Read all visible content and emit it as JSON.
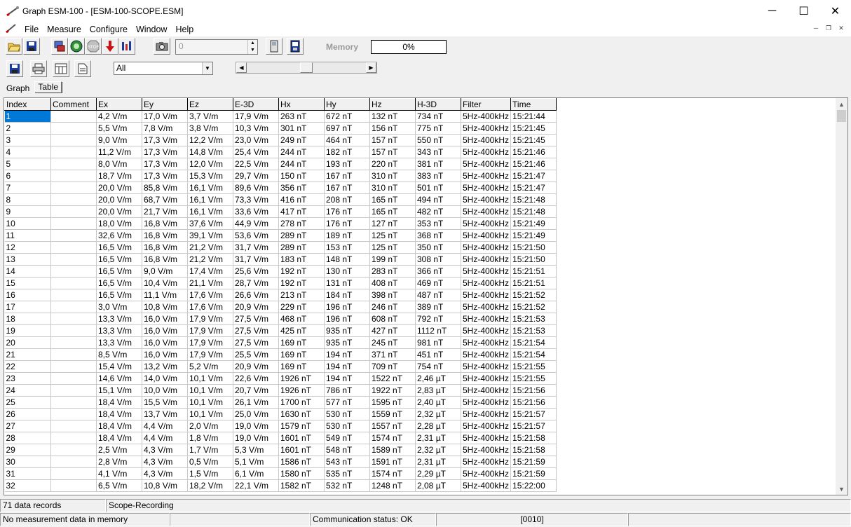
{
  "window": {
    "title": "Graph ESM-100 - [ESM-100-SCOPE.ESM]",
    "minimize": "─",
    "maximize": "☐",
    "close": "✕"
  },
  "menu": [
    "File",
    "Measure",
    "Configure",
    "Window",
    "Help"
  ],
  "toolbar": {
    "spin_value": "0",
    "memory_label": "Memory",
    "memory_progress_text": "0%",
    "memory_progress_fraction": 0.0,
    "filter_select": "All"
  },
  "tabs": {
    "graph": "Graph",
    "table": "Table",
    "active": "Table"
  },
  "table": {
    "columns": [
      "Index",
      "Comment",
      "Ex",
      "Ey",
      "Ez",
      "E-3D",
      "Hx",
      "Hy",
      "Hz",
      "H-3D",
      "Filter",
      "Time"
    ],
    "rows": [
      [
        "1",
        "",
        "4,2 V/m",
        "17,0 V/m",
        "3,7 V/m",
        "17,9 V/m",
        "263 nT",
        "672 nT",
        "132 nT",
        "734 nT",
        "5Hz-400kHz",
        "15:21:44"
      ],
      [
        "2",
        "",
        "5,5 V/m",
        "7,8 V/m",
        "3,8 V/m",
        "10,3 V/m",
        "301 nT",
        "697 nT",
        "156 nT",
        "775 nT",
        "5Hz-400kHz",
        "15:21:45"
      ],
      [
        "3",
        "",
        "9,0 V/m",
        "17,3 V/m",
        "12,2 V/m",
        "23,0 V/m",
        "249 nT",
        "464 nT",
        "157 nT",
        "550 nT",
        "5Hz-400kHz",
        "15:21:45"
      ],
      [
        "4",
        "",
        "11,2 V/m",
        "17,3 V/m",
        "14,8 V/m",
        "25,4 V/m",
        "244 nT",
        "182 nT",
        "157 nT",
        "343 nT",
        "5Hz-400kHz",
        "15:21:46"
      ],
      [
        "5",
        "",
        "8,0 V/m",
        "17,3 V/m",
        "12,0 V/m",
        "22,5 V/m",
        "244 nT",
        "193 nT",
        "220 nT",
        "381 nT",
        "5Hz-400kHz",
        "15:21:46"
      ],
      [
        "6",
        "",
        "18,7 V/m",
        "17,3 V/m",
        "15,3 V/m",
        "29,7 V/m",
        "150 nT",
        "167 nT",
        "310 nT",
        "383 nT",
        "5Hz-400kHz",
        "15:21:47"
      ],
      [
        "7",
        "",
        "20,0 V/m",
        "85,8 V/m",
        "16,1 V/m",
        "89,6 V/m",
        "356 nT",
        "167 nT",
        "310 nT",
        "501 nT",
        "5Hz-400kHz",
        "15:21:47"
      ],
      [
        "8",
        "",
        "20,0 V/m",
        "68,7 V/m",
        "16,1 V/m",
        "73,3 V/m",
        "416 nT",
        "208 nT",
        "165 nT",
        "494 nT",
        "5Hz-400kHz",
        "15:21:48"
      ],
      [
        "9",
        "",
        "20,0 V/m",
        "21,7 V/m",
        "16,1 V/m",
        "33,6 V/m",
        "417 nT",
        "176 nT",
        "165 nT",
        "482 nT",
        "5Hz-400kHz",
        "15:21:48"
      ],
      [
        "10",
        "",
        "18,0 V/m",
        "16,8 V/m",
        "37,6 V/m",
        "44,9 V/m",
        "278 nT",
        "176 nT",
        "127 nT",
        "353 nT",
        "5Hz-400kHz",
        "15:21:49"
      ],
      [
        "11",
        "",
        "32,6 V/m",
        "16,8 V/m",
        "39,1 V/m",
        "53,6 V/m",
        "289 nT",
        "189 nT",
        "125 nT",
        "368 nT",
        "5Hz-400kHz",
        "15:21:49"
      ],
      [
        "12",
        "",
        "16,5 V/m",
        "16,8 V/m",
        "21,2 V/m",
        "31,7 V/m",
        "289 nT",
        "153 nT",
        "125 nT",
        "350 nT",
        "5Hz-400kHz",
        "15:21:50"
      ],
      [
        "13",
        "",
        "16,5 V/m",
        "16,8 V/m",
        "21,2 V/m",
        "31,7 V/m",
        "183 nT",
        "148 nT",
        "199 nT",
        "308 nT",
        "5Hz-400kHz",
        "15:21:50"
      ],
      [
        "14",
        "",
        "16,5 V/m",
        "9,0 V/m",
        "17,4 V/m",
        "25,6 V/m",
        "192 nT",
        "130 nT",
        "283 nT",
        "366 nT",
        "5Hz-400kHz",
        "15:21:51"
      ],
      [
        "15",
        "",
        "16,5 V/m",
        "10,4 V/m",
        "21,1 V/m",
        "28,7 V/m",
        "192 nT",
        "131 nT",
        "408 nT",
        "469 nT",
        "5Hz-400kHz",
        "15:21:51"
      ],
      [
        "16",
        "",
        "16,5 V/m",
        "11,1 V/m",
        "17,6 V/m",
        "26,6 V/m",
        "213 nT",
        "184 nT",
        "398 nT",
        "487 nT",
        "5Hz-400kHz",
        "15:21:52"
      ],
      [
        "17",
        "",
        "3,0 V/m",
        "10,8 V/m",
        "17,6 V/m",
        "20,9 V/m",
        "229 nT",
        "196 nT",
        "246 nT",
        "389 nT",
        "5Hz-400kHz",
        "15:21:52"
      ],
      [
        "18",
        "",
        "13,3 V/m",
        "16,0 V/m",
        "17,9 V/m",
        "27,5 V/m",
        "468 nT",
        "196 nT",
        "608 nT",
        "792 nT",
        "5Hz-400kHz",
        "15:21:53"
      ],
      [
        "19",
        "",
        "13,3 V/m",
        "16,0 V/m",
        "17,9 V/m",
        "27,5 V/m",
        "425 nT",
        "935 nT",
        "427 nT",
        "1112 nT",
        "5Hz-400kHz",
        "15:21:53"
      ],
      [
        "20",
        "",
        "13,3 V/m",
        "16,0 V/m",
        "17,9 V/m",
        "27,5 V/m",
        "169 nT",
        "935 nT",
        "245 nT",
        "981 nT",
        "5Hz-400kHz",
        "15:21:54"
      ],
      [
        "21",
        "",
        "8,5 V/m",
        "16,0 V/m",
        "17,9 V/m",
        "25,5 V/m",
        "169 nT",
        "194 nT",
        "371 nT",
        "451 nT",
        "5Hz-400kHz",
        "15:21:54"
      ],
      [
        "22",
        "",
        "15,4 V/m",
        "13,2 V/m",
        "5,2 V/m",
        "20,9 V/m",
        "169 nT",
        "194 nT",
        "709 nT",
        "754 nT",
        "5Hz-400kHz",
        "15:21:55"
      ],
      [
        "23",
        "",
        "14,6 V/m",
        "14,0 V/m",
        "10,1 V/m",
        "22,6 V/m",
        "1926 nT",
        "194 nT",
        "1522 nT",
        "2,46 µT",
        "5Hz-400kHz",
        "15:21:55"
      ],
      [
        "24",
        "",
        "15,1 V/m",
        "10,0 V/m",
        "10,1 V/m",
        "20,7 V/m",
        "1926 nT",
        "786 nT",
        "1922 nT",
        "2,83 µT",
        "5Hz-400kHz",
        "15:21:56"
      ],
      [
        "25",
        "",
        "18,4 V/m",
        "15,5 V/m",
        "10,1 V/m",
        "26,1 V/m",
        "1700 nT",
        "577 nT",
        "1595 nT",
        "2,40 µT",
        "5Hz-400kHz",
        "15:21:56"
      ],
      [
        "26",
        "",
        "18,4 V/m",
        "13,7 V/m",
        "10,1 V/m",
        "25,0 V/m",
        "1630 nT",
        "530 nT",
        "1559 nT",
        "2,32 µT",
        "5Hz-400kHz",
        "15:21:57"
      ],
      [
        "27",
        "",
        "18,4 V/m",
        "4,4 V/m",
        "2,0 V/m",
        "19,0 V/m",
        "1579 nT",
        "530 nT",
        "1557 nT",
        "2,28 µT",
        "5Hz-400kHz",
        "15:21:57"
      ],
      [
        "28",
        "",
        "18,4 V/m",
        "4,4 V/m",
        "1,8 V/m",
        "19,0 V/m",
        "1601 nT",
        "549 nT",
        "1574 nT",
        "2,31 µT",
        "5Hz-400kHz",
        "15:21:58"
      ],
      [
        "29",
        "",
        "2,5 V/m",
        "4,3 V/m",
        "1,7 V/m",
        "5,3 V/m",
        "1601 nT",
        "548 nT",
        "1589 nT",
        "2,32 µT",
        "5Hz-400kHz",
        "15:21:58"
      ],
      [
        "30",
        "",
        "2,8 V/m",
        "4,3 V/m",
        "0,5 V/m",
        "5,1 V/m",
        "1586 nT",
        "543 nT",
        "1591 nT",
        "2,31 µT",
        "5Hz-400kHz",
        "15:21:59"
      ],
      [
        "31",
        "",
        "4,1 V/m",
        "4,3 V/m",
        "1,5 V/m",
        "6,1 V/m",
        "1580 nT",
        "535 nT",
        "1574 nT",
        "2,29 µT",
        "5Hz-400kHz",
        "15:21:59"
      ],
      [
        "32",
        "",
        "6,5 V/m",
        "10,8 V/m",
        "18,2 V/m",
        "22,1 V/m",
        "1582 nT",
        "532 nT",
        "1248 nT",
        "2,08 µT",
        "5Hz-400kHz",
        "15:22:00"
      ]
    ],
    "selected_row": 0
  },
  "status": {
    "records": "71 data records",
    "mode": "Scope-Recording",
    "memory_status": "No measurement data in memory",
    "communication": "Communication status: OK",
    "code": "[0010]"
  },
  "colors": {
    "selection": "#0078d7",
    "window_bg": "#f0f0f0"
  }
}
